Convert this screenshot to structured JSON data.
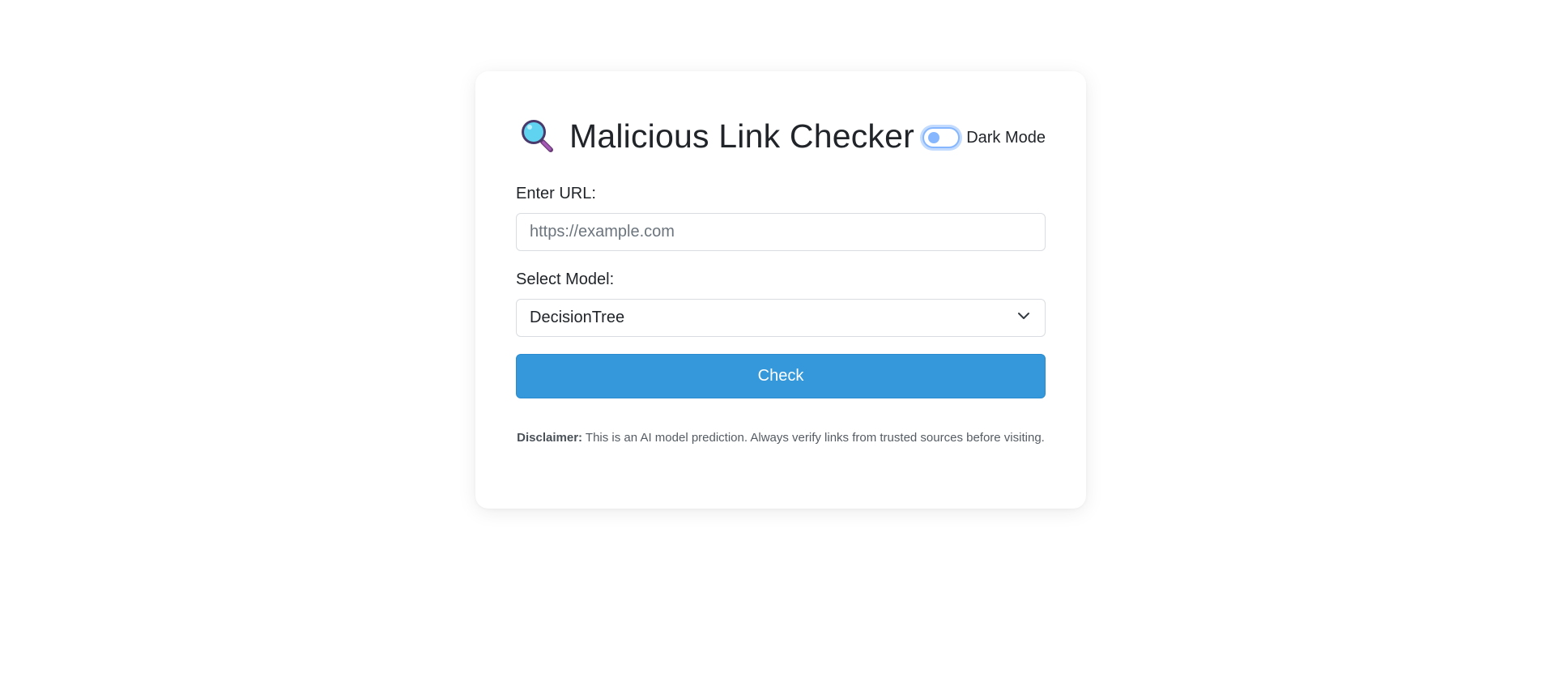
{
  "app": {
    "title": "Malicious Link Checker",
    "title_icon": "magnifying-glass-icon"
  },
  "dark_mode": {
    "label": "Dark Mode",
    "enabled": false
  },
  "url_field": {
    "label": "Enter URL:",
    "placeholder": "https://example.com",
    "value": ""
  },
  "model_field": {
    "label": "Select Model:",
    "selected": "DecisionTree",
    "icon": "chevron-down-icon"
  },
  "check_button": {
    "label": "Check"
  },
  "disclaimer": {
    "prefix": "Disclaimer:",
    "text": " This is an AI model prediction. Always verify links from trusted sources before visiting."
  },
  "colors": {
    "primary_button": "#3498db",
    "toggle_accent": "#86b7fe",
    "card_background": "#ffffff"
  }
}
